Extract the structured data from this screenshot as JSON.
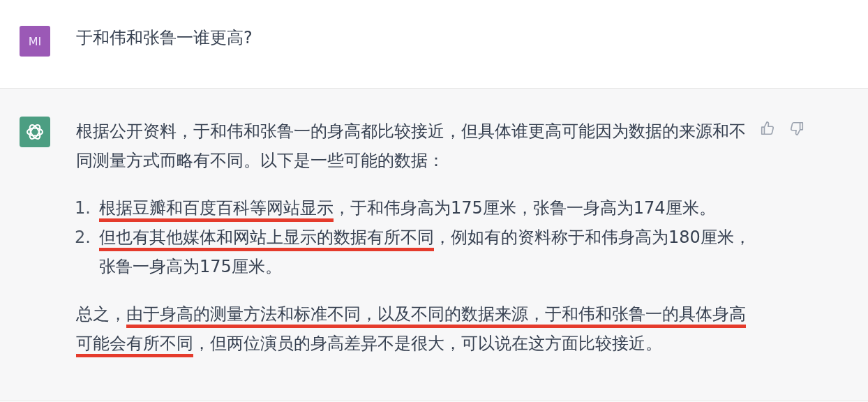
{
  "question": {
    "avatar": "MI",
    "text": "于和伟和张鲁一谁更高?"
  },
  "answer": {
    "intro": "根据公开资料，于和伟和张鲁一的身高都比较接近，但具体谁更高可能因为数据的来源和不同测量方式而略有不同。以下是一些可能的数据：",
    "items": [
      {
        "number": "1.",
        "segments": [
          {
            "text": "根据豆瓣和百度百科等网站显示",
            "marked": true
          },
          {
            "text": "，于和伟身高为175厘米，张鲁一身高为174厘米。",
            "marked": false
          }
        ]
      },
      {
        "number": "2.",
        "segments": [
          {
            "text": "但也有其他媒体和网站上显示的数据有所不同",
            "marked": true
          },
          {
            "text": "，例如有的资料称于和伟身高为180厘米，张鲁一身高为175厘米。",
            "marked": false
          }
        ]
      }
    ],
    "conclusion": [
      {
        "text": "总之，",
        "marked": false
      },
      {
        "text": "由于身高的测量方法和标准不同，以及不同的数据来源，于和伟和张鲁一的具体身高可能会有所不同",
        "marked": true
      },
      {
        "text": "，但两位演员的身高差异不是很大，可以说在这方面比较接近。",
        "marked": false
      }
    ]
  }
}
